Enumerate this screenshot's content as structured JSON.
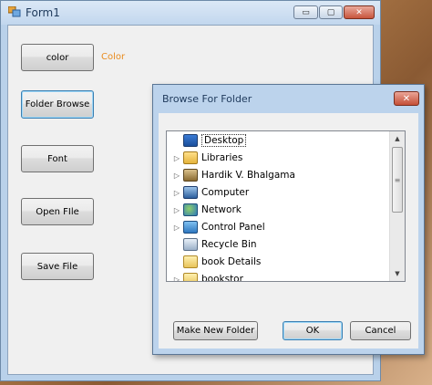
{
  "form": {
    "title": "Form1",
    "minimize_glyph": "▭",
    "maximize_glyph": "▢",
    "close_glyph": "✕",
    "buttons": {
      "color": "color",
      "folder_browse": "Folder Browse",
      "font": "Font",
      "open_file": "Open FIle",
      "save_file": "Save File"
    },
    "color_label": "Color",
    "color_label_color": "#e98b1e"
  },
  "dialog": {
    "title": "Browse For Folder",
    "close_glyph": "✕",
    "tree": [
      {
        "label": "Desktop",
        "icon": "desktop-icon",
        "expander": "",
        "selected": true
      },
      {
        "label": "Libraries",
        "icon": "libraries-icon",
        "expander": "▷"
      },
      {
        "label": "Hardik V. Bhalgama",
        "icon": "user-folder-icon",
        "expander": "▷"
      },
      {
        "label": "Computer",
        "icon": "computer-icon",
        "expander": "▷"
      },
      {
        "label": "Network",
        "icon": "network-icon",
        "expander": "▷"
      },
      {
        "label": "Control Panel",
        "icon": "control-panel-icon",
        "expander": "▷"
      },
      {
        "label": "Recycle Bin",
        "icon": "recycle-bin-icon",
        "expander": ""
      },
      {
        "label": "book Details",
        "icon": "folder-icon",
        "expander": ""
      },
      {
        "label": "bookstor",
        "icon": "folder-icon",
        "expander": "▷"
      }
    ],
    "scroll": {
      "up": "▲",
      "down": "▼",
      "grip": "≡"
    },
    "buttons": {
      "make_new_folder": "Make New Folder",
      "ok": "OK",
      "cancel": "Cancel"
    }
  }
}
